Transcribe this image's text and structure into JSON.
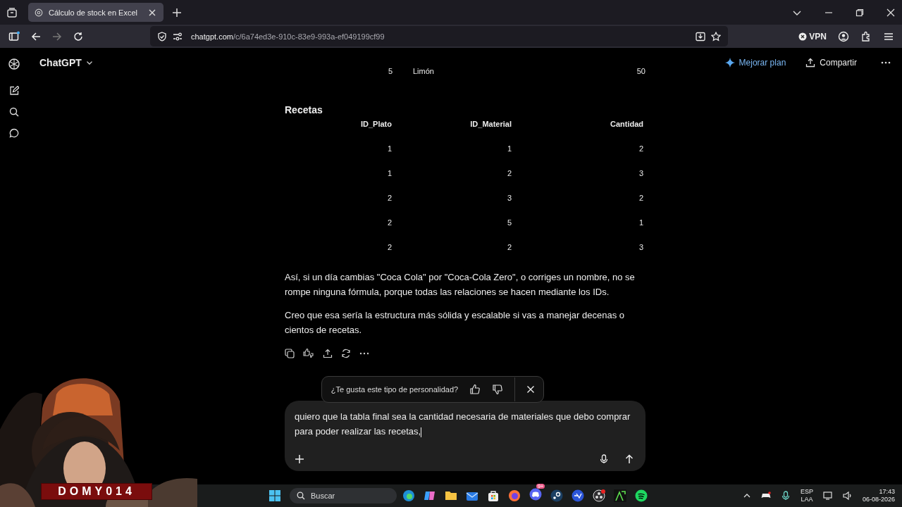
{
  "browser": {
    "tabs": [
      {
        "title": "Cálculo de stock en Excel",
        "selected": true
      }
    ],
    "url_host": "chatgpt.com",
    "url_path": "/c/6a74ed3e-910c-83e9-993a-ef049199cf99",
    "vpn_label": "VPN"
  },
  "header": {
    "app_name": "ChatGPT",
    "upgrade": "Mejorar plan",
    "share": "Compartir"
  },
  "materials_rows": [
    {
      "id": "5",
      "name": "Limón",
      "quantity": "50"
    }
  ],
  "recipes": {
    "title": "Recetas",
    "columns": [
      "ID_Plato",
      "ID_Material",
      "Cantidad"
    ],
    "rows": [
      [
        "1",
        "1",
        "2"
      ],
      [
        "1",
        "2",
        "3"
      ],
      [
        "2",
        "3",
        "2"
      ],
      [
        "2",
        "5",
        "1"
      ],
      [
        "2",
        "2",
        "3"
      ]
    ]
  },
  "paragraphs": [
    "Así, si un día cambias \"Coca Cola\" por \"Coca-Cola Zero\", o corriges un nombre, no se rompe ninguna fórmula, porque todas las relaciones se hacen mediante los IDs.",
    "Creo que esa sería la estructura más sólida y escalable si vas a manejar decenas o cientos de recetas."
  ],
  "feedback": {
    "question": "¿Te gusta este tipo de personalidad?"
  },
  "composer": {
    "value": "quiero que la tabla final sea la cantidad necesaria de materiales que debo comprar para poder realizar las recetas,"
  },
  "webcam": {
    "kind": "picture",
    "banner": "DOMY014"
  },
  "taskbar": {
    "search_placeholder": "Buscar",
    "discord_badge": "9+",
    "language": "ESP",
    "layout": "LAA",
    "time": "17:43",
    "date": "06-08-2026"
  }
}
